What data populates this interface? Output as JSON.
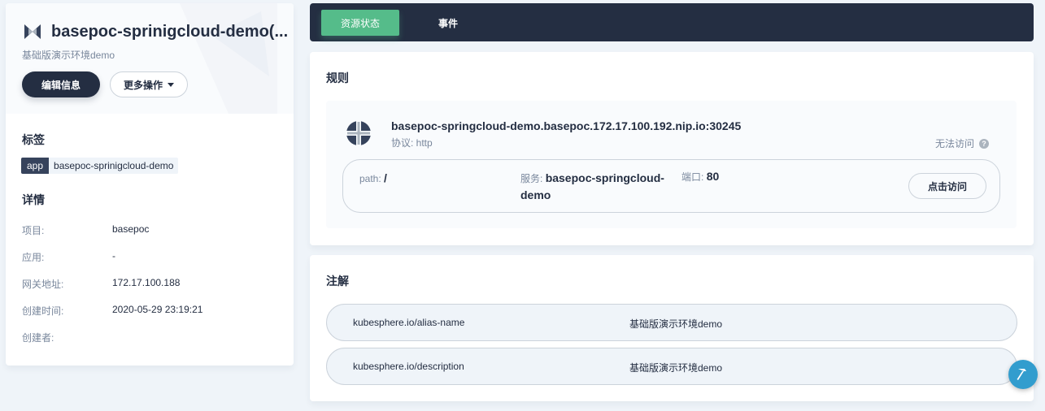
{
  "detail": {
    "title": "basepoc-sprinigcloud-demo(...",
    "subtitle": "基础版演示环境demo",
    "edit_button": "编辑信息",
    "more_button": "更多操作",
    "labels_title": "标签",
    "label": {
      "key": "app",
      "value": "basepoc-sprinigcloud-demo"
    },
    "details_title": "详情",
    "rows": [
      {
        "key": "项目:",
        "value": "basepoc"
      },
      {
        "key": "应用:",
        "value": "-"
      },
      {
        "key": "网关地址:",
        "value": "172.17.100.188"
      },
      {
        "key": "创建时间:",
        "value": "2020-05-29 23:19:21"
      },
      {
        "key": "创建者:",
        "value": ""
      }
    ]
  },
  "tabs": [
    {
      "label": "资源状态",
      "active": true
    },
    {
      "label": "事件",
      "active": false
    }
  ],
  "rules": {
    "title": "规则",
    "host": "basepoc-springcloud-demo.basepoc.172.17.100.192.nip.io:30245",
    "protocol_label": "协议: http",
    "status": "无法访问",
    "path_label": "path:",
    "path_value": "/",
    "service_label": "服务:",
    "service_value": "basepoc-springcloud-demo",
    "port_label": "端口:",
    "port_value": "80",
    "visit_button": "点击访问"
  },
  "annotations": {
    "title": "注解",
    "items": [
      {
        "key": "kubesphere.io/alias-name",
        "value": "基础版演示环境demo"
      },
      {
        "key": "kubesphere.io/description",
        "value": "基础版演示环境demo"
      }
    ]
  },
  "colors": {
    "dark": "#242e42",
    "accent": "#55bc8a",
    "float_button": "#329dce"
  }
}
